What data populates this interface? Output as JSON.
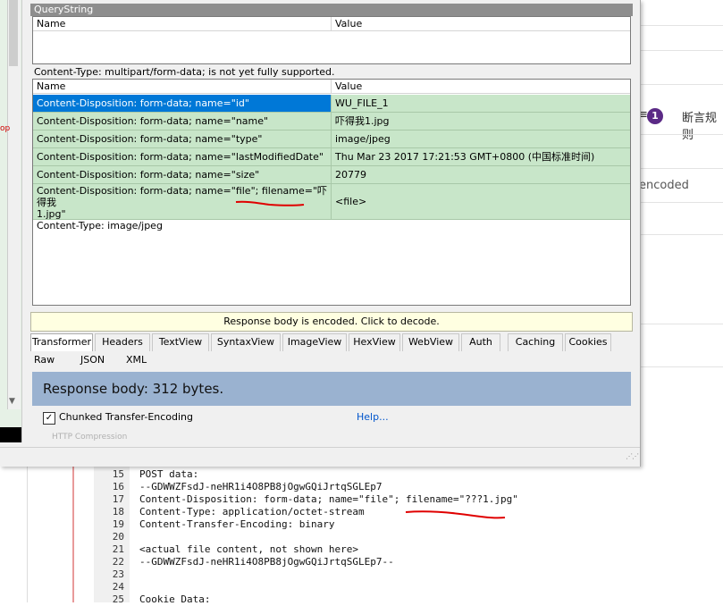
{
  "background": {
    "badge": "1",
    "right_text_1": "断言规则",
    "right_text_2": "encoded",
    "eq": "≡"
  },
  "querystring": {
    "title": "QueryString",
    "columns": [
      "Name",
      "Value"
    ]
  },
  "webforms": {
    "notice": "Content-Type: multipart/form-data; is not yet fully supported.",
    "columns": [
      "Name",
      "Value"
    ],
    "rows": [
      {
        "name": "Content-Disposition: form-data; name=\"id\"",
        "value": "WU_FILE_1"
      },
      {
        "name": "Content-Disposition: form-data; name=\"name\"",
        "value": "吓得我1.jpg"
      },
      {
        "name": "Content-Disposition: form-data; name=\"type\"",
        "value": "image/jpeg"
      },
      {
        "name": "Content-Disposition: form-data; name=\"lastModifiedDate\"",
        "value": "Thu Mar 23 2017 17:21:53 GMT+0800 (中国标准时间)"
      },
      {
        "name": "Content-Disposition: form-data; name=\"size\"",
        "value": "20779"
      },
      {
        "name_line1": "Content-Disposition: form-data; name=\"file\"; filename=\"吓得我",
        "name_line2": "1.jpg\"",
        "name_line3": "Content-Type: image/jpeg",
        "value": "<file>"
      }
    ]
  },
  "response": {
    "encoded_notice": "Response body is encoded. Click to decode.",
    "tabs": [
      "Transformer",
      "Headers",
      "TextView",
      "SyntaxView",
      "ImageView",
      "HexView",
      "WebView",
      "Auth",
      "Caching",
      "Cookies"
    ],
    "tabs2": [
      "Raw",
      "JSON",
      "XML"
    ],
    "body_size": "Response body: 312 bytes.",
    "chunked_label": "Chunked Transfer-Encoding",
    "chunked_check": "✓",
    "help": "Help...",
    "faded": "HTTP Compression"
  },
  "editor": {
    "lines": [
      {
        "n": "15",
        "t": "POST data:"
      },
      {
        "n": "16",
        "t": "--GDWWZFsdJ-neHR1i4O8PB8jOgwGQiJrtqSGLEp7"
      },
      {
        "n": "17",
        "t": "Content-Disposition: form-data; name=\"file\"; filename=\"???1.jpg\""
      },
      {
        "n": "18",
        "t": "Content-Type: application/octet-stream"
      },
      {
        "n": "19",
        "t": "Content-Transfer-Encoding: binary"
      },
      {
        "n": "20",
        "t": ""
      },
      {
        "n": "21",
        "t": "<actual file content, not shown here>"
      },
      {
        "n": "22",
        "t": "--GDWWZFsdJ-neHR1i4O8PB8jOgwGQiJrtqSGLEp7--"
      },
      {
        "n": "23",
        "t": ""
      },
      {
        "n": "24",
        "t": ""
      },
      {
        "n": "25",
        "t": "Cookie Data:"
      }
    ]
  },
  "colors": {
    "row_green": "#c8e6c9",
    "selected_blue": "#0078d7",
    "response_blue": "#9ab2d0",
    "annotation_red": "#e00000"
  }
}
